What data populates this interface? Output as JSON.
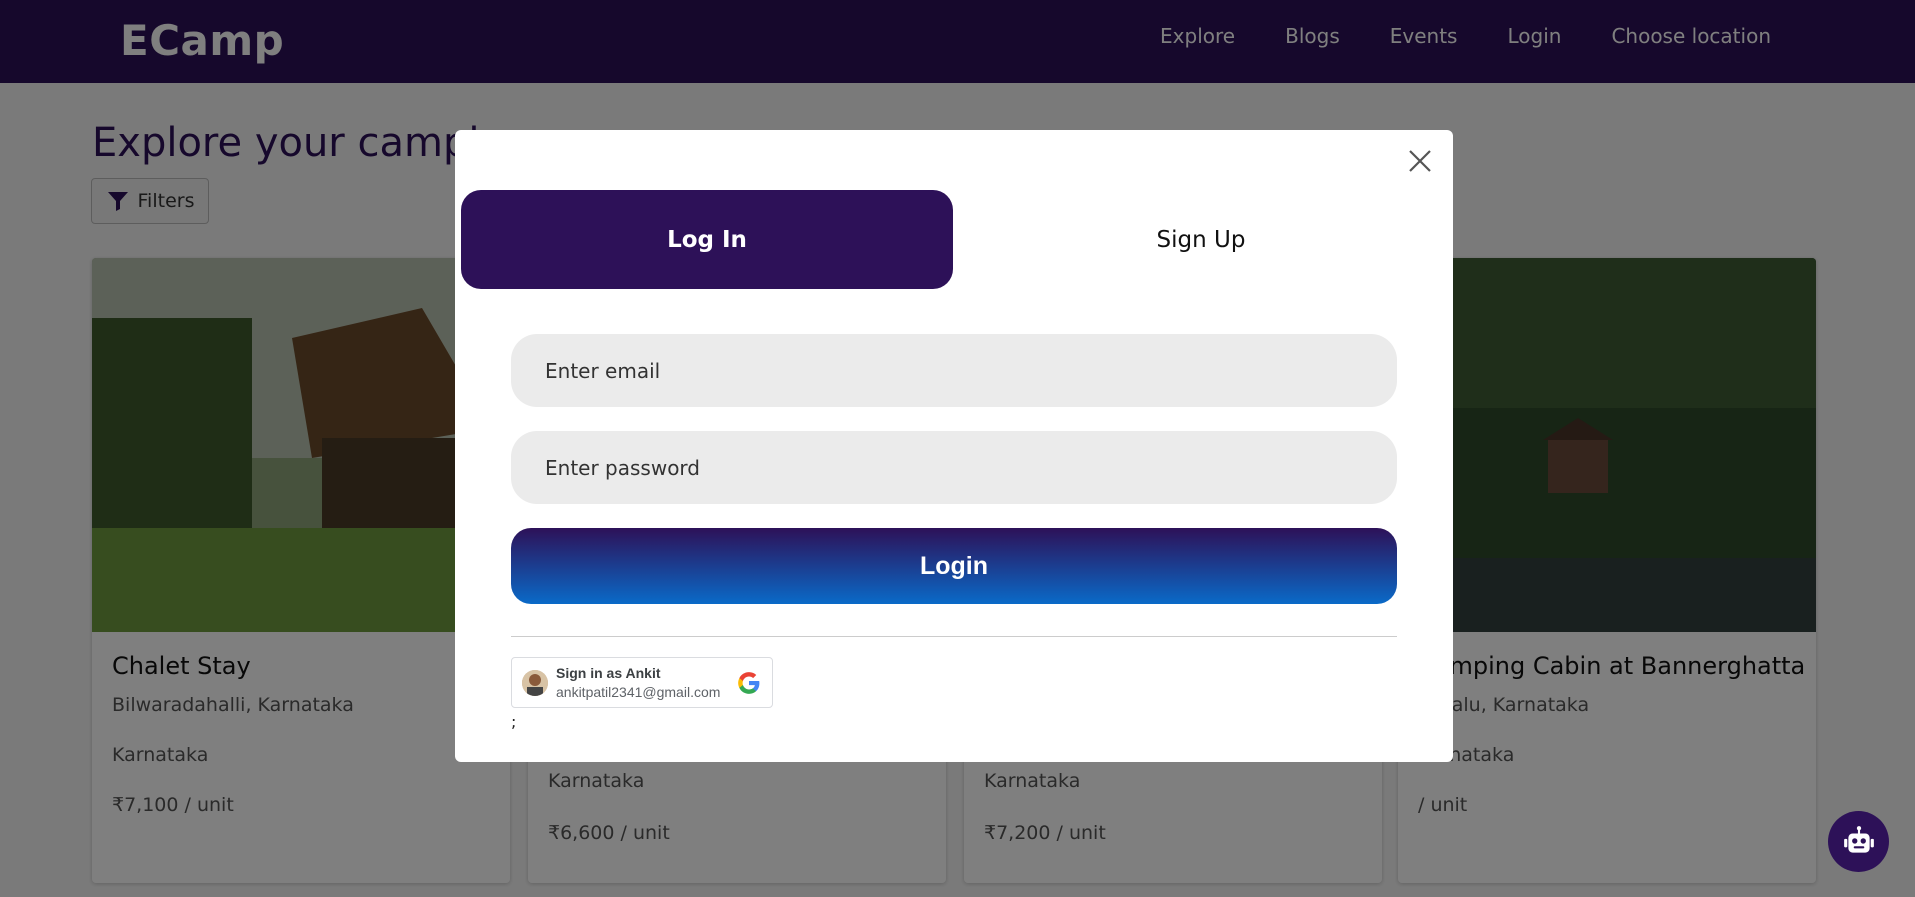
{
  "navbar": {
    "brand": "ECamp",
    "links": [
      "Explore",
      "Blogs",
      "Events",
      "Login",
      "Choose location"
    ]
  },
  "page": {
    "title": "Explore your camping",
    "filters_label": "Filters"
  },
  "cards": [
    {
      "title": "Chalet Stay",
      "location": "Bilwaradahalli, Karnataka",
      "state": "Karnataka",
      "price": "₹7,100 / unit"
    },
    {
      "title": "",
      "location": "",
      "state": "Karnataka",
      "price": "₹6,600 / unit"
    },
    {
      "title": "",
      "location": "",
      "state": "Karnataka",
      "price": "₹7,200 / unit"
    },
    {
      "title": "Camping Cabin at Bannerghatta",
      "location": "Haralu, Karnataka",
      "state": "Karnataka",
      "price": "/ unit"
    }
  ],
  "modal": {
    "tabs": {
      "login": "Log In",
      "signup": "Sign Up"
    },
    "email_placeholder": "Enter email",
    "password_placeholder": "Enter password",
    "login_button": "Login",
    "google": {
      "name_label": "Sign in as Ankit",
      "email": "ankitpatil2341@gmail.com"
    },
    "trailing_text": ";"
  },
  "colors": {
    "brand": "#2d1158",
    "login_gradient_end": "#0a6ac8"
  }
}
